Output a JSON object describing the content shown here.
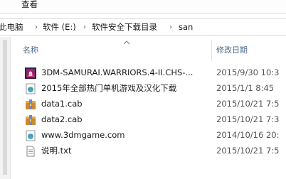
{
  "ribbon": {
    "view_tab": "查看"
  },
  "address": {
    "crumbs": [
      "此电脑",
      "软件 (E:)",
      "软件安全下载目录",
      "san"
    ],
    "separator": "›"
  },
  "columns": {
    "name": "名称",
    "modified": "修改日期"
  },
  "files": [
    {
      "name": "3DM-SAMURAI.WARRIORS.4-II.CHS-...",
      "date": "2015/9/30 10:3",
      "icon": "game-exe-icon"
    },
    {
      "name": "2015年全部热门单机游戏及汉化下载",
      "date": "2015/1/1 8:45",
      "icon": "internet-shortcut-icon"
    },
    {
      "name": "data1.cab",
      "date": "2015/10/21 7:5",
      "icon": "cab-archive-icon"
    },
    {
      "name": "data2.cab",
      "date": "2015/10/21 7:3",
      "icon": "cab-archive-icon"
    },
    {
      "name": "www.3dmgame.com",
      "date": "2014/10/16 20:",
      "icon": "internet-shortcut-icon"
    },
    {
      "name": "说明.txt",
      "date": "2015/10/21 7:5",
      "icon": "text-file-icon"
    }
  ]
}
